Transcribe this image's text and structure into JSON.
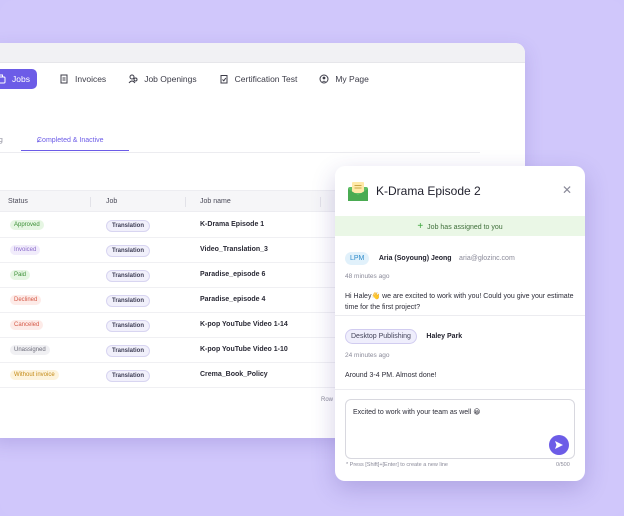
{
  "nav": {
    "items": [
      {
        "label": "Jobs",
        "icon": "briefcase-icon"
      },
      {
        "label": "Invoices",
        "icon": "invoice-icon"
      },
      {
        "label": "Job Openings",
        "icon": "people-icon"
      },
      {
        "label": "Certification Test",
        "icon": "clipboard-icon"
      },
      {
        "label": "My Page",
        "icon": "user-icon"
      }
    ]
  },
  "tabs": {
    "left_partial": "ng",
    "active": "Completed & Inactive"
  },
  "table": {
    "headers": [
      "Status",
      "Job",
      "Job name"
    ],
    "rows": [
      {
        "status": "Approved",
        "job": "Translation",
        "name": "K-Drama Episode 1"
      },
      {
        "status": "Invoiced",
        "job": "Translation",
        "name": "Video_Translation_3"
      },
      {
        "status": "Paid",
        "job": "Translation",
        "name": "Paradise_episode 6"
      },
      {
        "status": "Declined",
        "job": "Translation",
        "name": "Paradise_episode 4"
      },
      {
        "status": "Canceled",
        "job": "Translation",
        "name": "K-pop YouTube Video 1-14"
      },
      {
        "status": "Unassigned",
        "job": "Translation",
        "name": "K-pop YouTube Video 1-10"
      },
      {
        "status": "Without invoice",
        "job": "Translation",
        "name": "Crema_Book_Policy"
      }
    ],
    "footer_label": "Row"
  },
  "status_colors": {
    "Approved": {
      "bg": "#e6f6e3",
      "fg": "#3a8e35"
    },
    "Invoiced": {
      "bg": "#f1ecfb",
      "fg": "#8a6acb"
    },
    "Paid": {
      "bg": "#e6f6e3",
      "fg": "#3a8e35"
    },
    "Declined": {
      "bg": "#fdebe8",
      "fg": "#d55a48"
    },
    "Canceled": {
      "bg": "#fdebe8",
      "fg": "#d55a48"
    },
    "Unassigned": {
      "bg": "#f0f0f3",
      "fg": "#6a6a78"
    },
    "Without invoice": {
      "bg": "#fdf3dc",
      "fg": "#c38a16"
    }
  },
  "panel": {
    "title": "K-Drama Episode 2",
    "assign_text": "Job has assigned to you",
    "message1": {
      "tag": "LPM",
      "sender": "Aria (Soyoung) Jeong",
      "email": "aria@glozinc.com",
      "time": "48 minutes ago",
      "text": "Hi Haley👋 we are excited to work with you! Could you give your estimate time for the first project?"
    },
    "message2": {
      "tag": "Desktop Publishing",
      "sender": "Haley Park",
      "time": "24 minutes ago",
      "text": "Around 3-4 PM. Almost done!"
    },
    "input_value": "Excited to work with your team as well 😀",
    "hint": "* Press [Shift]+[Enter] to create a new line",
    "counter": "0/500"
  },
  "colors": {
    "accent": "#6c5ce7",
    "background": "#d0c7fb"
  }
}
